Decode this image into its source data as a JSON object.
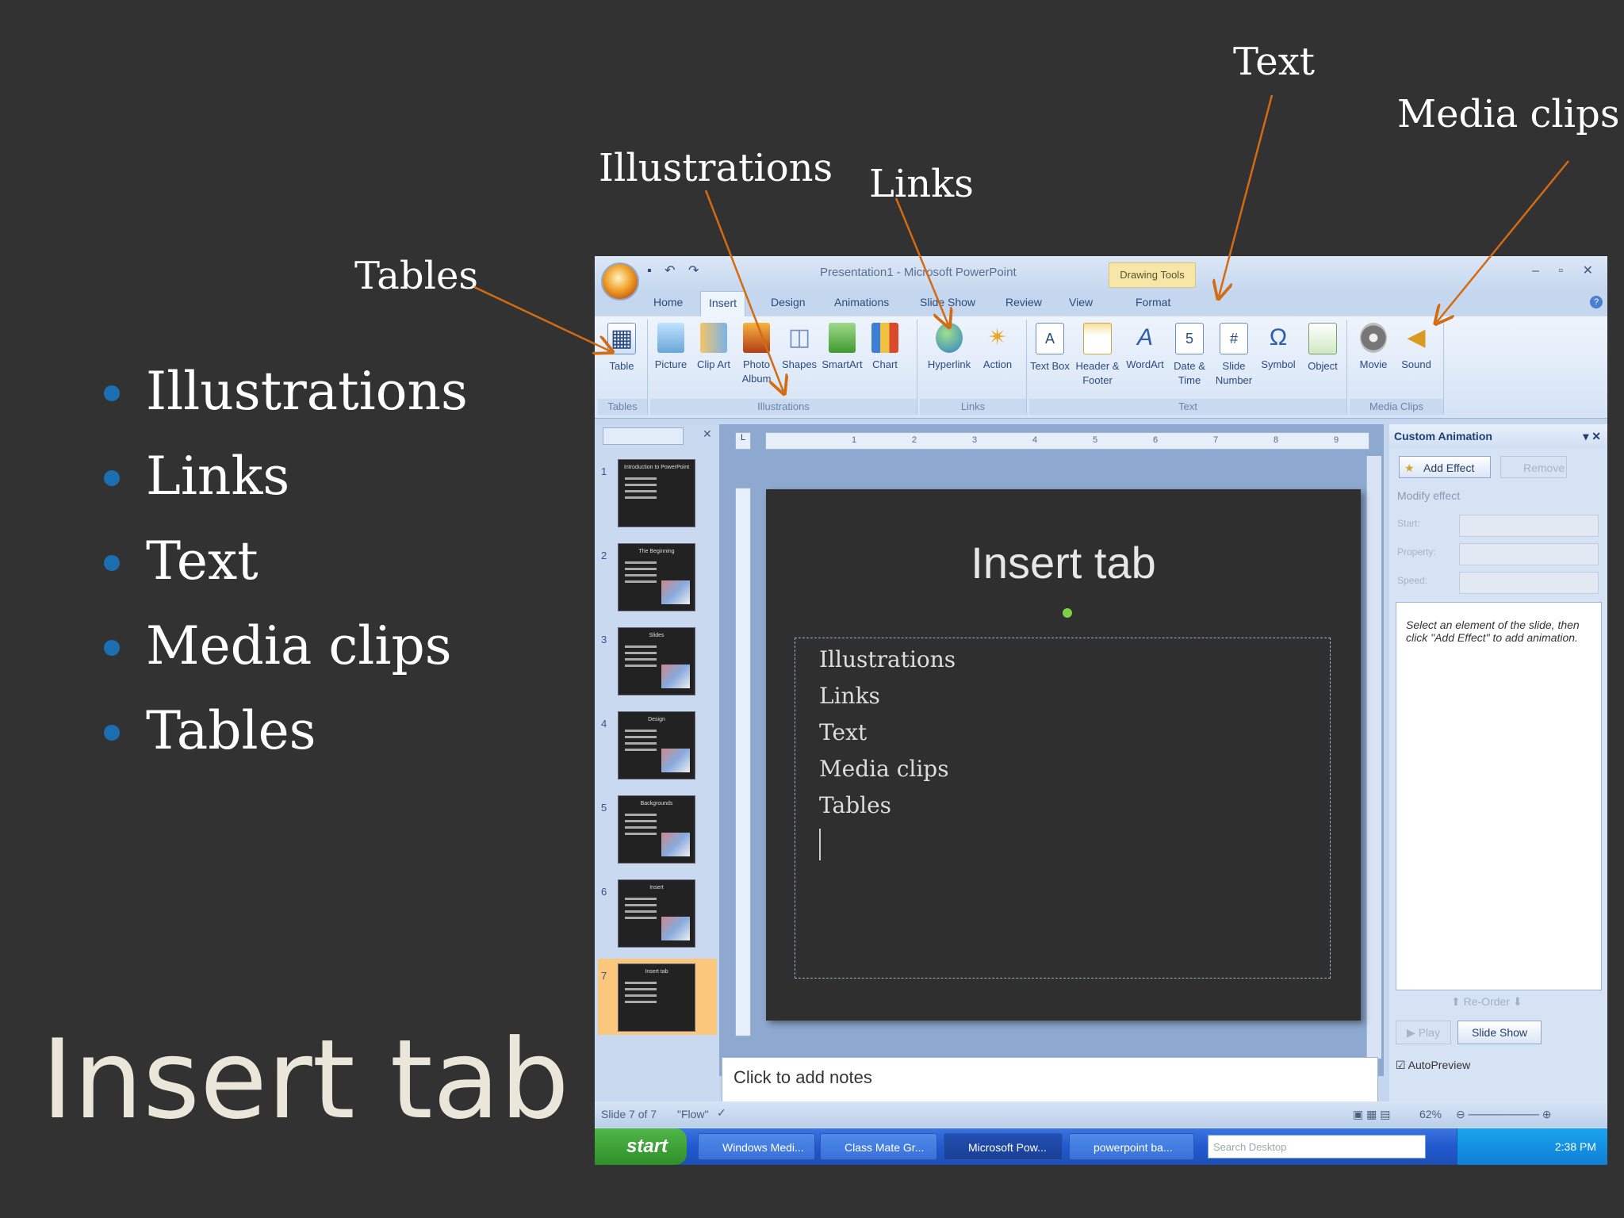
{
  "slide": {
    "bullets": [
      "Illustrations",
      "Links",
      "Text",
      "Media clips",
      "Tables"
    ],
    "title": "Insert tab",
    "callouts": {
      "tables": "Tables",
      "illustrations": "Illustrations",
      "links": "Links",
      "text": "Text",
      "media_clips": "Media clips"
    }
  },
  "colors": {
    "background": "#323232",
    "bullet": "#1b6fb0",
    "title": "#eae6d9",
    "arrow": "#d36b12"
  },
  "powerpoint": {
    "window_title": "Presentation1 - Microsoft PowerPoint",
    "contextual_tab": "Drawing Tools",
    "tabs": [
      "Home",
      "Insert",
      "Design",
      "Animations",
      "Slide Show",
      "Review",
      "View",
      "Format"
    ],
    "active_tab": "Insert",
    "groups": {
      "tables": {
        "label": "Tables",
        "buttons": [
          "Table"
        ]
      },
      "illustrations": {
        "label": "Illustrations",
        "buttons": [
          "Picture",
          "Clip Art",
          "Photo Album",
          "Shapes",
          "SmartArt",
          "Chart"
        ]
      },
      "links": {
        "label": "Links",
        "buttons": [
          "Hyperlink",
          "Action"
        ]
      },
      "text": {
        "label": "Text",
        "buttons": [
          "Text Box",
          "Header & Footer",
          "WordArt",
          "Date & Time",
          "Slide Number",
          "Symbol",
          "Object"
        ]
      },
      "media": {
        "label": "Media Clips",
        "buttons": [
          "Movie",
          "Sound"
        ]
      }
    },
    "thumbnails": [
      {
        "num": "1",
        "title": "Introduction to PowerPoint"
      },
      {
        "num": "2",
        "title": "The Beginning"
      },
      {
        "num": "3",
        "title": "Slides"
      },
      {
        "num": "4",
        "title": "Design"
      },
      {
        "num": "5",
        "title": "Backgrounds"
      },
      {
        "num": "6",
        "title": "Insert"
      },
      {
        "num": "7",
        "title": "Insert tab"
      }
    ],
    "ruler_ticks": [
      "1",
      "2",
      "3",
      "4",
      "5",
      "6",
      "7",
      "8",
      "9"
    ],
    "current_slide": {
      "title": "Insert tab",
      "bullets": [
        "Illustrations",
        "Links",
        "Text",
        "Media clips",
        "Tables"
      ]
    },
    "notes_placeholder": "Click to add notes",
    "custom_animation": {
      "title": "Custom Animation",
      "add_effect": "Add Effect",
      "remove": "Remove",
      "modify_effect": "Modify effect",
      "start_label": "Start:",
      "property_label": "Property:",
      "speed_label": "Speed:",
      "hint": "Select an element of the slide, then click \"Add Effect\" to add animation.",
      "reorder": "Re-Order",
      "play": "Play",
      "slide_show": "Slide Show",
      "autopreview": "AutoPreview"
    },
    "status": {
      "slide_of": "Slide 7 of 7",
      "theme": "\"Flow\"",
      "zoom": "62%"
    },
    "taskbar": {
      "start": "start",
      "items": [
        "Windows Medi...",
        "Class Mate Gr...",
        "Microsoft Pow...",
        "powerpoint ba..."
      ],
      "search_placeholder": "Search Desktop",
      "clock": "2:38 PM"
    }
  }
}
